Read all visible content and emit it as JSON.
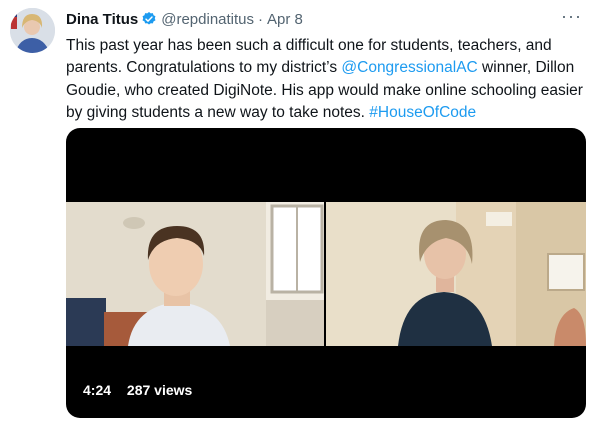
{
  "author": {
    "name": "Dina Titus",
    "handle": "@repdinatitus",
    "separator": "·",
    "date": "Apr 8",
    "verified_color": "#1d9bf0"
  },
  "more_menu": "···",
  "tweet": {
    "segments": [
      {
        "text": "This past year has been such a difficult one for students, teachers, and parents. Congratulations to my district’s ",
        "link": false
      },
      {
        "text": "@CongressionalAC",
        "link": true
      },
      {
        "text": " winner, Dillon Goudie, who created DigiNote. His app would make online schooling easier by giving students a new way to take notes. ",
        "link": false
      },
      {
        "text": "#HouseOfCode",
        "link": true
      }
    ]
  },
  "video": {
    "duration": "4:24",
    "views": "287 views"
  },
  "colors": {
    "link": "#1d9bf0",
    "secondary_text": "#536471",
    "video_bg": "#000000"
  }
}
